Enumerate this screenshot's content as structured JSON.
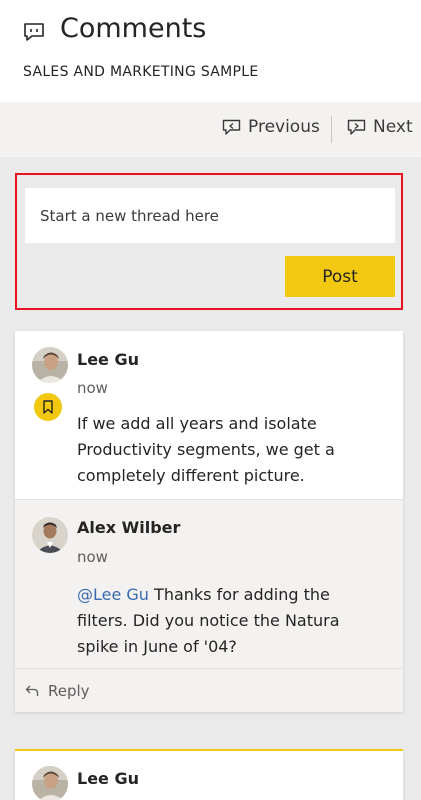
{
  "header": {
    "title": "Comments",
    "subtitle": "SALES AND MARKETING SAMPLE",
    "icon": "comments-icon"
  },
  "navigation": {
    "previous_label": "Previous",
    "next_label": "Next"
  },
  "new_thread": {
    "placeholder": "Start a new thread here",
    "post_label": "Post"
  },
  "threads": [
    {
      "author": "Lee Gu",
      "time": "now",
      "text": "If we add all years and isolate Productivity segments, we get a completely different picture.",
      "bookmarked": true,
      "replies": [
        {
          "author": "Alex Wilber",
          "time": "now",
          "mention": "@Lee Gu",
          "text": " Thanks for adding the filters. Did you notice the Natura spike in June of '04?"
        }
      ],
      "reply_label": "Reply"
    },
    {
      "author": "Lee Gu"
    }
  ],
  "colors": {
    "accent_yellow": "#f2c811",
    "highlight_border": "#e81123",
    "mention": "#3a6ab0"
  }
}
